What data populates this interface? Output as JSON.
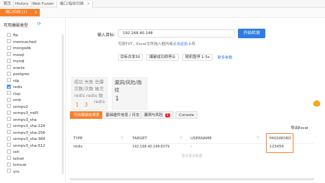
{
  "top_tabs": [
    "首页",
    "History",
    "Web Fuzzer",
    "端口/指纹扫描"
  ],
  "editor_tab": {
    "label": "端口扫描 [1]",
    "close": "×"
  },
  "sidebar": {
    "title": "可用爆破类型",
    "items": [
      {
        "label": "ftp",
        "checked": false
      },
      {
        "label": "memcached",
        "checked": false
      },
      {
        "label": "mongodb",
        "checked": false
      },
      {
        "label": "mssql",
        "checked": false
      },
      {
        "label": "mysql",
        "checked": false
      },
      {
        "label": "oracle",
        "checked": false
      },
      {
        "label": "postgres",
        "checked": false
      },
      {
        "label": "rdp",
        "checked": false
      },
      {
        "label": "redis",
        "checked": true
      },
      {
        "label": "rtsp",
        "checked": false
      },
      {
        "label": "smb",
        "checked": false
      },
      {
        "label": "snmpv2",
        "checked": false
      },
      {
        "label": "snmpv3_md5",
        "checked": false
      },
      {
        "label": "snmpv3_sha",
        "checked": false
      },
      {
        "label": "snmpv3_sha-224",
        "checked": false
      },
      {
        "label": "snmpv3_sha-256",
        "checked": false
      },
      {
        "label": "snmpv3_sha-384",
        "checked": false
      },
      {
        "label": "snmpv3_sha-512",
        "checked": false
      },
      {
        "label": "ssh",
        "checked": false
      },
      {
        "label": "telnet",
        "checked": false
      },
      {
        "label": "tomcat",
        "checked": false
      },
      {
        "label": "vnc",
        "checked": false
      }
    ]
  },
  "form": {
    "input_label": "输入目标:",
    "input_value": "192.168.40.148",
    "start_button": "开始检测",
    "hint_prefix": "可用TXT、Excel文件拖入框内或",
    "hint_link": "点击此处",
    "hint_suffix": "上传",
    "chips": [
      "目标并发50",
      "爆破成功即停止",
      "随机暂停 1-5s"
    ],
    "more_params": "更多参数"
  },
  "status_card": {
    "line1": "成功 失败 总爆",
    "line2": "次数/次数 破次",
    "line3": "redis redis 数",
    "line4": "redis",
    "count1": "1",
    "count2": "3"
  },
  "vuln_card": {
    "line1": "漏洞/风险/指",
    "line2": "纹",
    "count": "1"
  },
  "result_tabs": [
    {
      "label": "可用爆破结果表",
      "badge": ""
    },
    {
      "label": "基础插件信息 / 日志",
      "badge": ""
    },
    {
      "label": "漏洞与风险",
      "badge": "1"
    },
    {
      "label": "Console",
      "badge": ""
    }
  ],
  "export_label": "导出Excel",
  "table": {
    "headers": [
      "TYPE",
      "TARGET",
      "USERNAME",
      "PASSWORD"
    ],
    "rows": [
      {
        "type": "redis",
        "target": "192.168.40.148:6379",
        "username": "-",
        "password": "123456"
      }
    ],
    "footer": "暂无更多数据"
  },
  "colors": {
    "accent": "#f97d27",
    "primary": "#2f7de1",
    "checked": "#3a8ee6"
  }
}
